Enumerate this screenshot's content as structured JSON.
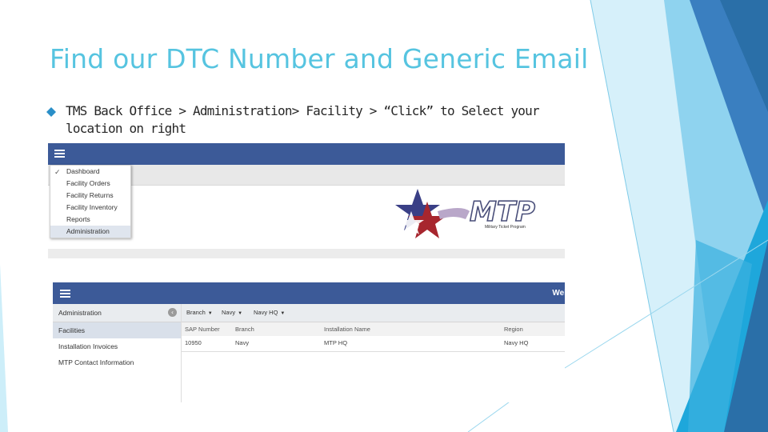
{
  "slide": {
    "title": "Find our DTC Number and Generic Email",
    "bullet": "TMS Back Office > Administration> Facility > “Click” to Select your location on right"
  },
  "colors": {
    "title": "#56c4e0",
    "navbar": "#3c5a98",
    "accent_light": "#a8def2",
    "accent_mid": "#3ab0e0",
    "accent_dark": "#2a6fa8"
  },
  "screenshot1": {
    "menu": [
      {
        "label": "Dashboard",
        "checked": true
      },
      {
        "label": "Facility Orders"
      },
      {
        "label": "Facility Returns"
      },
      {
        "label": "Facility Inventory"
      },
      {
        "label": "Reports"
      },
      {
        "label": "Administration",
        "active": true
      }
    ],
    "logo": {
      "text": "MTP",
      "subtext": "Military Ticket Program"
    }
  },
  "screenshot2": {
    "welcome": "Wel",
    "sidebar": {
      "header": "Administration",
      "items": [
        "Facilities",
        "Installation Invoices",
        "MTP Contact Information"
      ]
    },
    "filters": [
      "Branch",
      "Navy",
      "Navy HQ"
    ],
    "table": {
      "columns": [
        "SAP Number",
        "Branch",
        "Installation Name",
        "Region"
      ],
      "rows": [
        [
          "10950",
          "Navy",
          "MTP HQ",
          "Navy HQ"
        ]
      ]
    }
  }
}
